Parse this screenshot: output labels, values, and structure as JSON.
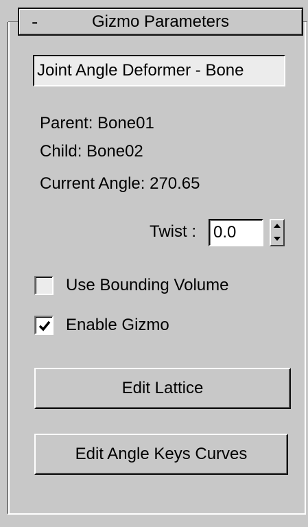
{
  "rollout": {
    "collapse_symbol": "-",
    "title": "Gizmo Parameters"
  },
  "name_field": {
    "value": "Joint Angle Deformer - Bone"
  },
  "info": {
    "parent": "Parent: Bone01",
    "child": "Child: Bone02",
    "current_angle": "Current Angle: 270.65"
  },
  "twist": {
    "label": "Twist :",
    "value": "0.0",
    "spinner_icon": "spinner-up-down-icon"
  },
  "checkboxes": [
    {
      "label": "Use Bounding Volume",
      "checked": false
    },
    {
      "label": "Enable Gizmo",
      "checked": true
    }
  ],
  "buttons": {
    "edit_lattice": "Edit Lattice",
    "edit_angle_keys": "Edit Angle Keys Curves"
  },
  "colors": {
    "panel_bg": "#c8c8c8",
    "field_bg": "#ececec"
  }
}
